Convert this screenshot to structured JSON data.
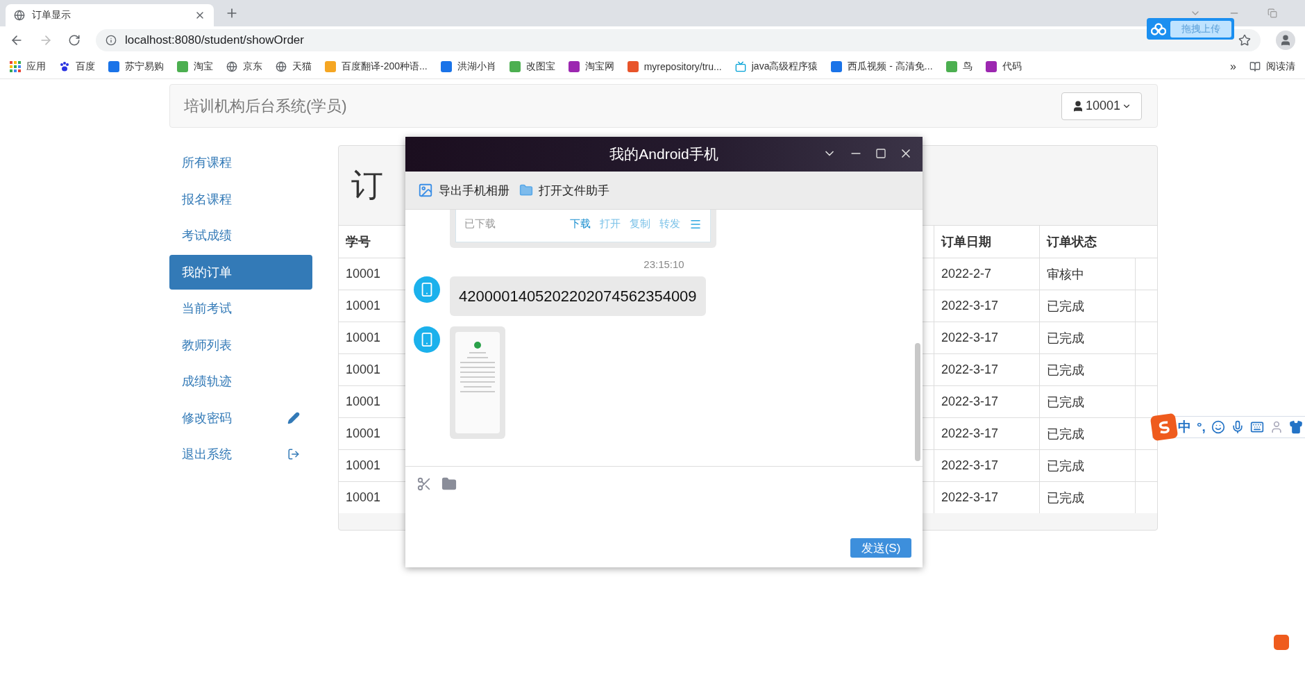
{
  "browser": {
    "tab": {
      "title": "订单显示"
    },
    "address": "localhost:8080/student/showOrder",
    "bookmarks": [
      {
        "label": "应用",
        "kind": "apps"
      },
      {
        "label": "百度",
        "kind": "paw"
      },
      {
        "label": "苏宁易购",
        "kind": "badge"
      },
      {
        "label": "淘宝",
        "kind": "badge"
      },
      {
        "label": "京东",
        "kind": "globe"
      },
      {
        "label": "天猫",
        "kind": "globe"
      },
      {
        "label": "百度翻译-200种语...",
        "kind": "badge"
      },
      {
        "label": "洪湖小肖",
        "kind": "badge"
      },
      {
        "label": "改图宝",
        "kind": "badge"
      },
      {
        "label": "淘宝网",
        "kind": "badge"
      },
      {
        "label": "myrepository/tru...",
        "kind": "badge"
      },
      {
        "label": "java高级程序猿",
        "kind": "tv"
      },
      {
        "label": "西瓜视频 - 高清免...",
        "kind": "badge"
      },
      {
        "label": "鸟",
        "kind": "badge"
      },
      {
        "label": "代码",
        "kind": "badge"
      }
    ],
    "more": "»",
    "reading_list": "阅读清",
    "upload_widget": "拖拽上传"
  },
  "navbar": {
    "brand": "培训机构后台系统(学员)",
    "user": "10001"
  },
  "sidebar": [
    {
      "label": "所有课程",
      "selected": false,
      "kind": "link"
    },
    {
      "label": "报名课程",
      "selected": false,
      "kind": "link"
    },
    {
      "label": "考试成绩",
      "selected": false,
      "kind": "link"
    },
    {
      "label": "我的订单",
      "selected": true,
      "kind": "link"
    },
    {
      "label": "当前考试",
      "selected": false,
      "kind": "link"
    },
    {
      "label": "教师列表",
      "selected": false,
      "kind": "link"
    },
    {
      "label": "成绩轨迹",
      "selected": false,
      "kind": "link"
    },
    {
      "label": "修改密码",
      "selected": false,
      "kind": "edit"
    },
    {
      "label": "退出系统",
      "selected": false,
      "kind": "logout"
    }
  ],
  "panel": {
    "heading": "订",
    "table": {
      "columns": [
        "学号",
        "订单日期",
        "订单状态"
      ],
      "rows": [
        {
          "student_id": "10001",
          "order_date": "2022-2-7",
          "status": "审核中"
        },
        {
          "student_id": "10001",
          "order_date": "2022-3-17",
          "status": "已完成"
        },
        {
          "student_id": "10001",
          "order_date": "2022-3-17",
          "status": "已完成"
        },
        {
          "student_id": "10001",
          "order_date": "2022-3-17",
          "status": "已完成"
        },
        {
          "student_id": "10001",
          "order_date": "2022-3-17",
          "status": "已完成"
        },
        {
          "student_id": "10001",
          "order_date": "2022-3-17",
          "status": "已完成"
        },
        {
          "student_id": "10001",
          "order_date": "2022-3-17",
          "status": "已完成"
        },
        {
          "student_id": "10001",
          "order_date": "2022-3-17",
          "status": "已完成"
        }
      ]
    }
  },
  "dialog": {
    "title": "我的Android手机",
    "toolbar": [
      {
        "label": "导出手机相册",
        "kind": "album"
      },
      {
        "label": "打开文件助手",
        "kind": "folder"
      }
    ],
    "file_card": {
      "status": "已下载",
      "actions": [
        {
          "label": "下载",
          "active": true
        },
        {
          "label": "打开",
          "active": false
        },
        {
          "label": "复制",
          "active": false
        },
        {
          "label": "转发",
          "active": false
        }
      ]
    },
    "timestamp": "23:15:10",
    "message": "4200001405202202074562354009",
    "send": "发送(S)"
  },
  "ime": {
    "mode": "中",
    "punct": "°,"
  }
}
